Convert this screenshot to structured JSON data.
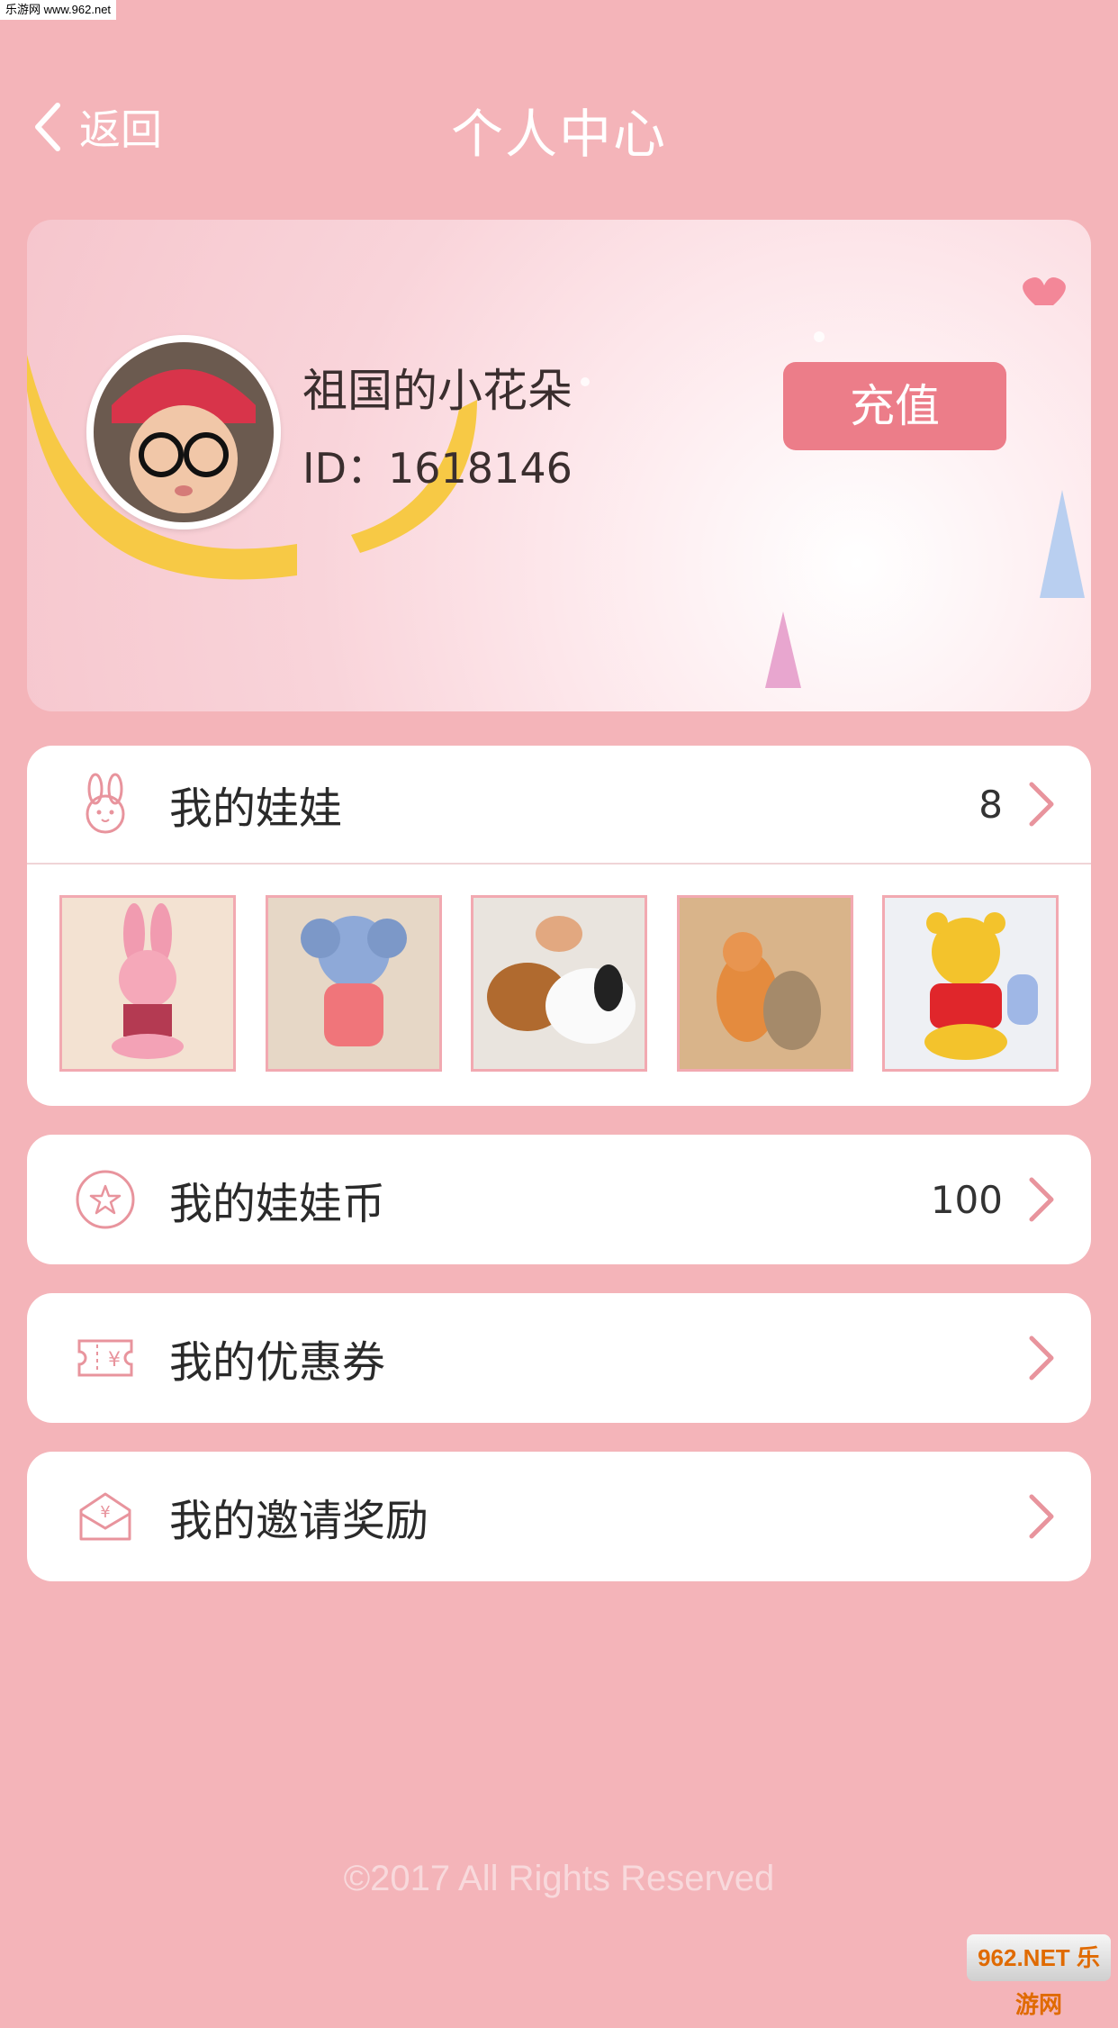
{
  "watermark_top": "乐游网 www.962.net",
  "header": {
    "back_label": "返回",
    "title": "个人中心"
  },
  "profile": {
    "nickname": "祖国的小花朵",
    "id_text": "ID：1618146",
    "recharge_label": "充值"
  },
  "dolls": {
    "label": "我的娃娃",
    "count": "8"
  },
  "coins": {
    "label": "我的娃娃币",
    "count": "100"
  },
  "coupons": {
    "label": "我的优惠券"
  },
  "invite": {
    "label": "我的邀请奖励"
  },
  "footer": "©2017 All Rights Reserved",
  "watermark_bottom": "962.NET 乐游网",
  "colors": {
    "background": "#f4b4b9",
    "accent": "#ec7d89",
    "icon": "#e8949d"
  }
}
